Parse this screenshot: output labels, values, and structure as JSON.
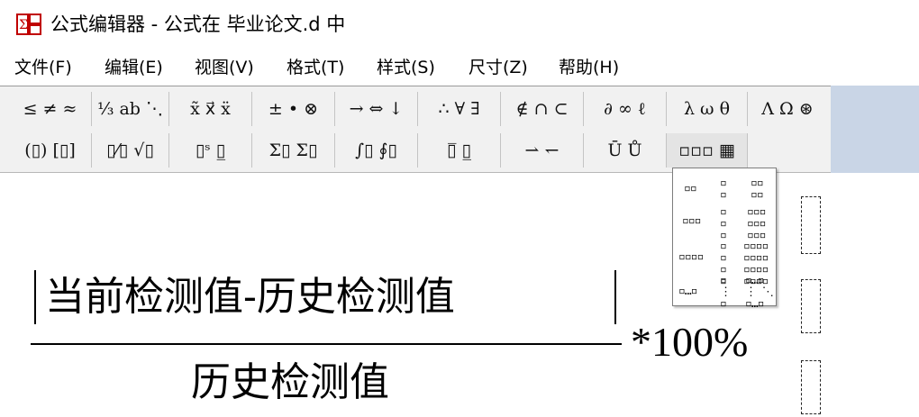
{
  "window": {
    "title": "公式编辑器 - 公式在 毕业论文.d 中",
    "icon": "formula-editor-icon"
  },
  "menu": {
    "items": [
      "文件(F)",
      "编辑(E)",
      "视图(V)",
      "格式(T)",
      "样式(S)",
      "尺寸(Z)",
      "帮助(H)"
    ]
  },
  "toolbar": {
    "row1": [
      {
        "name": "relations-palette",
        "label": "≤ ≠ ≈"
      },
      {
        "name": "spaces-ellipses-palette",
        "label": "⅓ ab ⋱"
      },
      {
        "name": "embellishments-palette",
        "label": "x̃ x⃗ ẍ"
      },
      {
        "name": "operators-palette",
        "label": "± • ⊗"
      },
      {
        "name": "arrows-palette",
        "label": "→ ⇔ ↓"
      },
      {
        "name": "logic-palette",
        "label": "∴ ∀ ∃"
      },
      {
        "name": "set-theory-palette",
        "label": "∉ ∩ ⊂"
      },
      {
        "name": "misc-symbols-palette",
        "label": "∂ ∞ ℓ"
      },
      {
        "name": "greek-lowercase-palette",
        "label": "λ ω θ"
      },
      {
        "name": "greek-uppercase-palette",
        "label": "Λ Ω ⊛"
      }
    ],
    "row2": [
      {
        "name": "fences-palette",
        "label": "(▯) [▯]"
      },
      {
        "name": "fractions-radicals-palette",
        "label": "▯⁄▯ √▯"
      },
      {
        "name": "subscript-superscript-palette",
        "label": "▯ˢ ▯̲"
      },
      {
        "name": "summation-palette",
        "label": "Σ▯ Σ▯"
      },
      {
        "name": "integrals-palette",
        "label": "∫▯ ∮▯"
      },
      {
        "name": "underbar-overbar-palette",
        "label": "▯̅ ▯̲"
      },
      {
        "name": "labeled-arrows-palette",
        "label": "⇀ ↽"
      },
      {
        "name": "products-set-palette",
        "label": "Ū Ů"
      },
      {
        "name": "matrices-palette",
        "label": "▫▫▫ ▦"
      }
    ]
  },
  "matrix_dropdown": {
    "items": [
      "1x2",
      "2x1",
      "2x2",
      "1x3",
      "3x1",
      "3x3",
      "1x4",
      "4x1",
      "4x4",
      "1xn",
      "nx1",
      "nxn"
    ]
  },
  "equation": {
    "numerator": "当前检测值-历史检测值",
    "denominator": "历史检测值",
    "multiplier": "*100%"
  }
}
